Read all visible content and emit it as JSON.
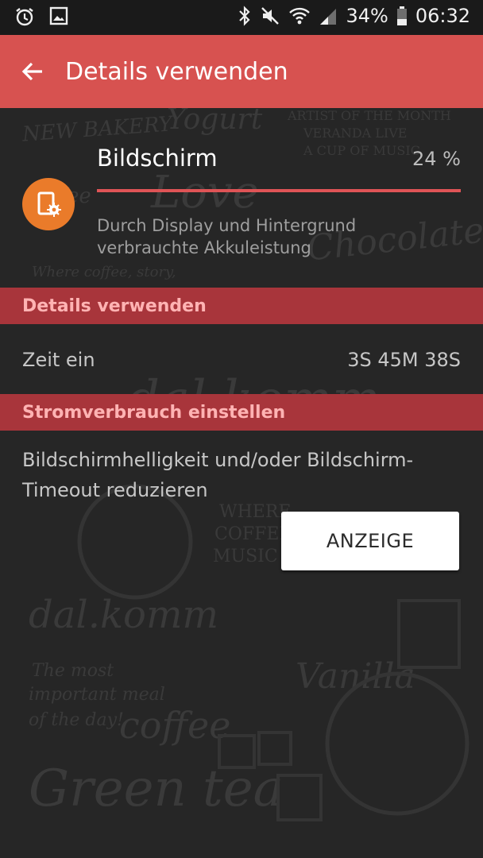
{
  "status_bar": {
    "battery_percent": "34%",
    "time": "06:32",
    "icons": [
      "alarm-icon",
      "image-icon",
      "bluetooth-icon",
      "mute-icon",
      "wifi-icon",
      "signal-icon",
      "battery-icon"
    ]
  },
  "app_bar": {
    "back_icon": "arrow-left-icon",
    "title": "Details verwenden"
  },
  "item": {
    "icon": "screen-settings-icon",
    "icon_color": "#ea7b2a",
    "title": "Bildschirm",
    "percent_label": "24 %",
    "usage_fraction": 1.0,
    "description": "Durch Display und Hintergrund verbrauchte Akkuleistung"
  },
  "sections": {
    "details_header": "Details verwenden",
    "power_header": "Stromverbrauch einstellen"
  },
  "details": {
    "time_on_label": "Zeit ein",
    "time_on_value": "3S 45M 38S"
  },
  "power": {
    "tip": "Bildschirmhelligkeit und/oder Bildschirm-Timeout reduzieren",
    "button_label": "ANZEIGE"
  },
  "colors": {
    "accent": "#d75250",
    "section_bg": "#a8353b",
    "section_text": "#ffb3b3",
    "background": "#262626"
  },
  "background_doodle": {
    "texts": [
      "NEW BAKERY",
      "Yogurt",
      "ARTIST OF THE MONTH",
      "VERANDA LIVE",
      "A CUP OF MUSIC",
      "Coffee",
      "Love",
      "Chocolate",
      "Where coffee, story,",
      "dal.komm",
      "WHERE",
      "COFFEE &",
      "MUSIC MEET",
      "Vanilla",
      "The most",
      "important meal",
      "of the day!",
      "coffee",
      "Green tea"
    ]
  }
}
